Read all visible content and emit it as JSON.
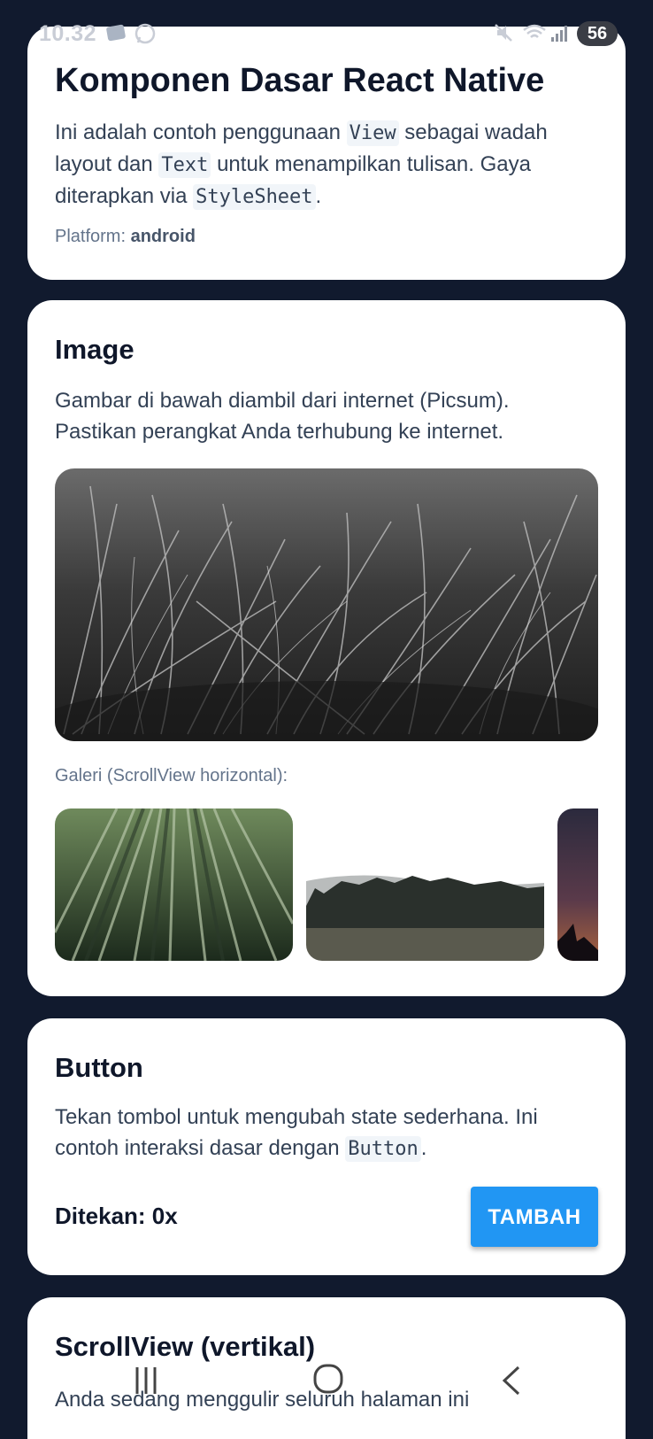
{
  "status_bar": {
    "time": "10.32",
    "battery": "56",
    "icons": [
      "gallery-app-icon",
      "whatsapp-icon",
      "mute-icon",
      "wifi-icon",
      "signal-icon",
      "battery-icon"
    ]
  },
  "header_card": {
    "title": "Komponen Dasar React Native",
    "desc_part1": "Ini adalah contoh penggunaan ",
    "code_view": "View",
    "desc_part2": " sebagai wadah layout dan ",
    "code_text": "Text",
    "desc_part3": " untuk menampilkan tulisan. Gaya diterapkan via ",
    "code_stylesheet": "StyleSheet",
    "desc_part4": ".",
    "platform_label": "Platform: ",
    "platform_value": "android"
  },
  "image_card": {
    "title": "Image",
    "desc": "Gambar di bawah diambil dari internet (Picsum). Pastikan perangkat Anda terhubung ke internet.",
    "gallery_label": "Galeri (ScrollView horizontal):"
  },
  "button_card": {
    "title": "Button",
    "desc_part1": "Tekan tombol untuk mengubah state sederhana. Ini contoh interaksi dasar dengan ",
    "code_button": "Button",
    "desc_part2": ".",
    "counter_text": "Ditekan: 0x",
    "button_label": "TAMBAH"
  },
  "scroll_card": {
    "title": "ScrollView (vertikal)",
    "desc": "Anda sedang menggulir seluruh halaman ini"
  },
  "colors": {
    "background": "#111a2e",
    "card": "#ffffff",
    "button": "#2196f3",
    "text_primary": "#0f172a"
  }
}
